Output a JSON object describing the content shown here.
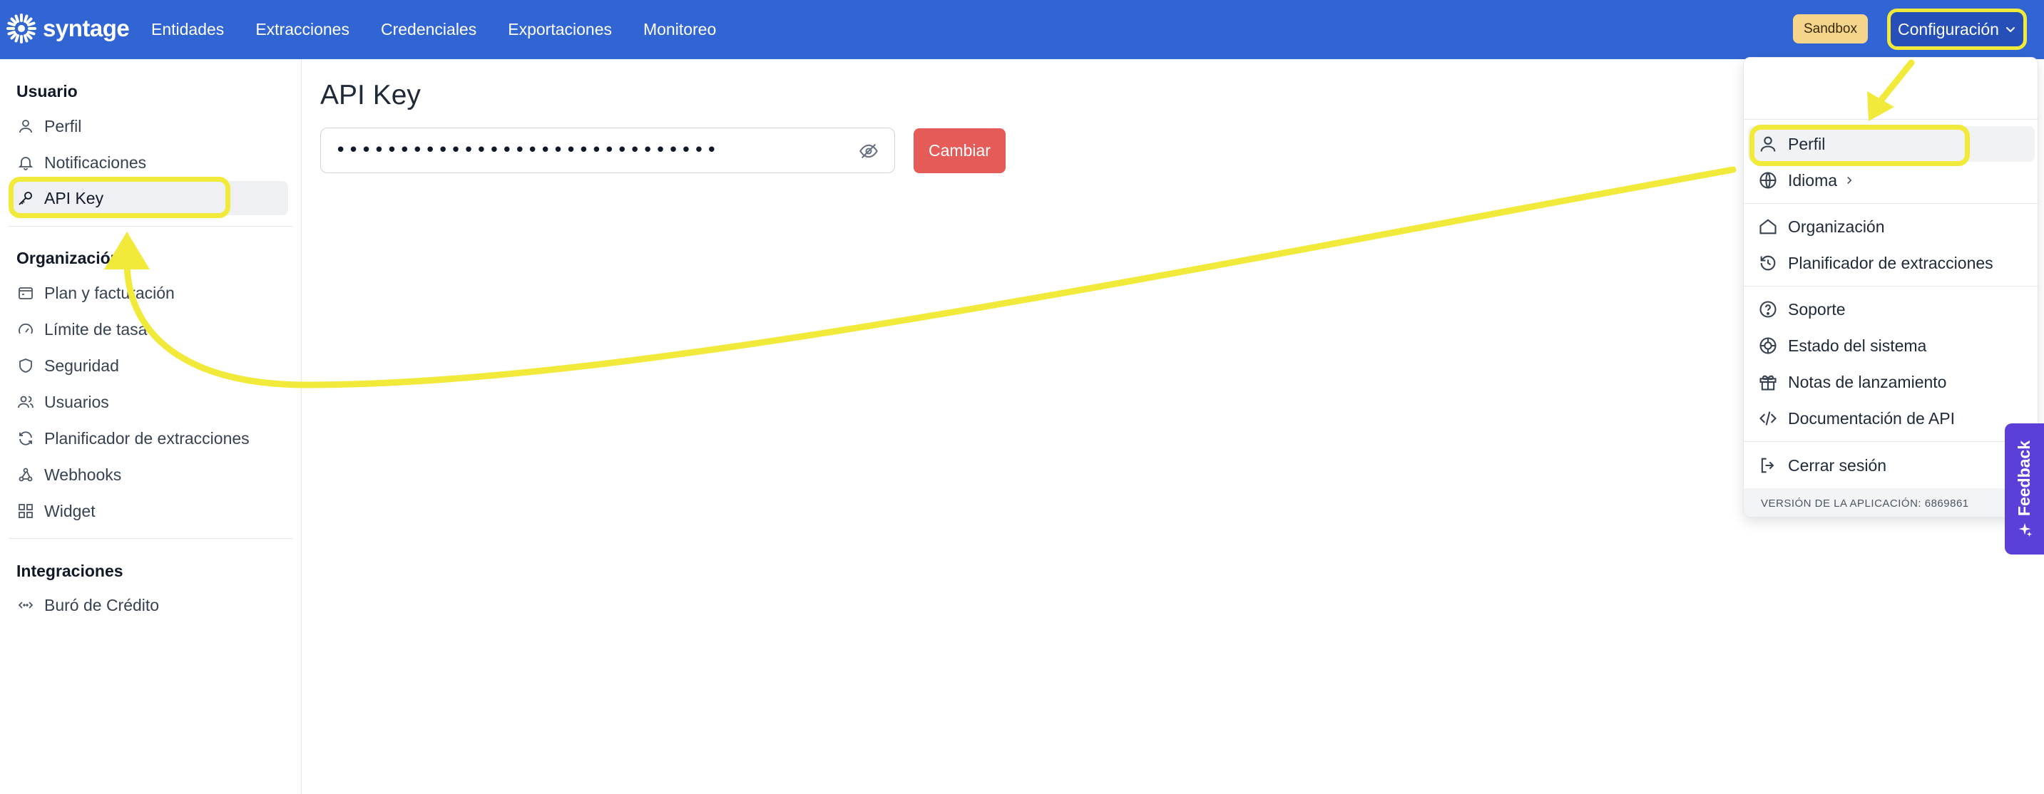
{
  "app": {
    "logo_text": "syntage",
    "nav": [
      "Entidades",
      "Extracciones",
      "Credenciales",
      "Exportaciones",
      "Monitoreo"
    ],
    "env_badge": "Sandbox",
    "config_label": "Configuración"
  },
  "sidebar": {
    "sections": [
      {
        "title": "Usuario",
        "items": [
          {
            "label": "Perfil",
            "icon": "user-icon"
          },
          {
            "label": "Notificaciones",
            "icon": "bell-icon"
          },
          {
            "label": "API Key",
            "icon": "key-icon",
            "active": true
          }
        ]
      },
      {
        "title": "Organización",
        "items": [
          {
            "label": "Plan y facturación",
            "icon": "billing-icon"
          },
          {
            "label": "Límite de tasa",
            "icon": "gauge-icon"
          },
          {
            "label": "Seguridad",
            "icon": "shield-icon"
          },
          {
            "label": "Usuarios",
            "icon": "users-icon"
          },
          {
            "label": "Planificador de extracciones",
            "icon": "refresh-icon"
          },
          {
            "label": "Webhooks",
            "icon": "webhook-icon"
          },
          {
            "label": "Widget",
            "icon": "widget-icon"
          }
        ]
      },
      {
        "title": "Integraciones",
        "items": [
          {
            "label": "Buró de Crédito",
            "icon": "code-arrows-icon"
          }
        ]
      }
    ]
  },
  "main": {
    "title": "API Key",
    "masked_key": "••••••••••••••••••••••••••••••",
    "change_button": "Cambiar"
  },
  "menu": {
    "items": [
      {
        "label": "Perfil",
        "icon": "user-icon"
      },
      {
        "label": "Idioma",
        "icon": "globe-icon"
      },
      {
        "label": "Organización",
        "icon": "home-icon"
      },
      {
        "label": "Planificador de extracciones",
        "icon": "history-icon"
      },
      {
        "label": "Soporte",
        "icon": "help-icon"
      },
      {
        "label": "Estado del sistema",
        "icon": "status-icon"
      },
      {
        "label": "Notas de lanzamiento",
        "icon": "gift-icon"
      },
      {
        "label": "Documentación de API",
        "icon": "code-icon"
      },
      {
        "label": "Cerrar sesión",
        "icon": "logout-icon"
      }
    ],
    "footer": "VERSIÓN DE LA APLICACIÓN: 6869861"
  },
  "feedback_label": "Feedback",
  "colors": {
    "nav": "#3165d4",
    "highlight": "#f2ea3a",
    "danger": "#e45b57",
    "feedback": "#5b3fd8"
  }
}
